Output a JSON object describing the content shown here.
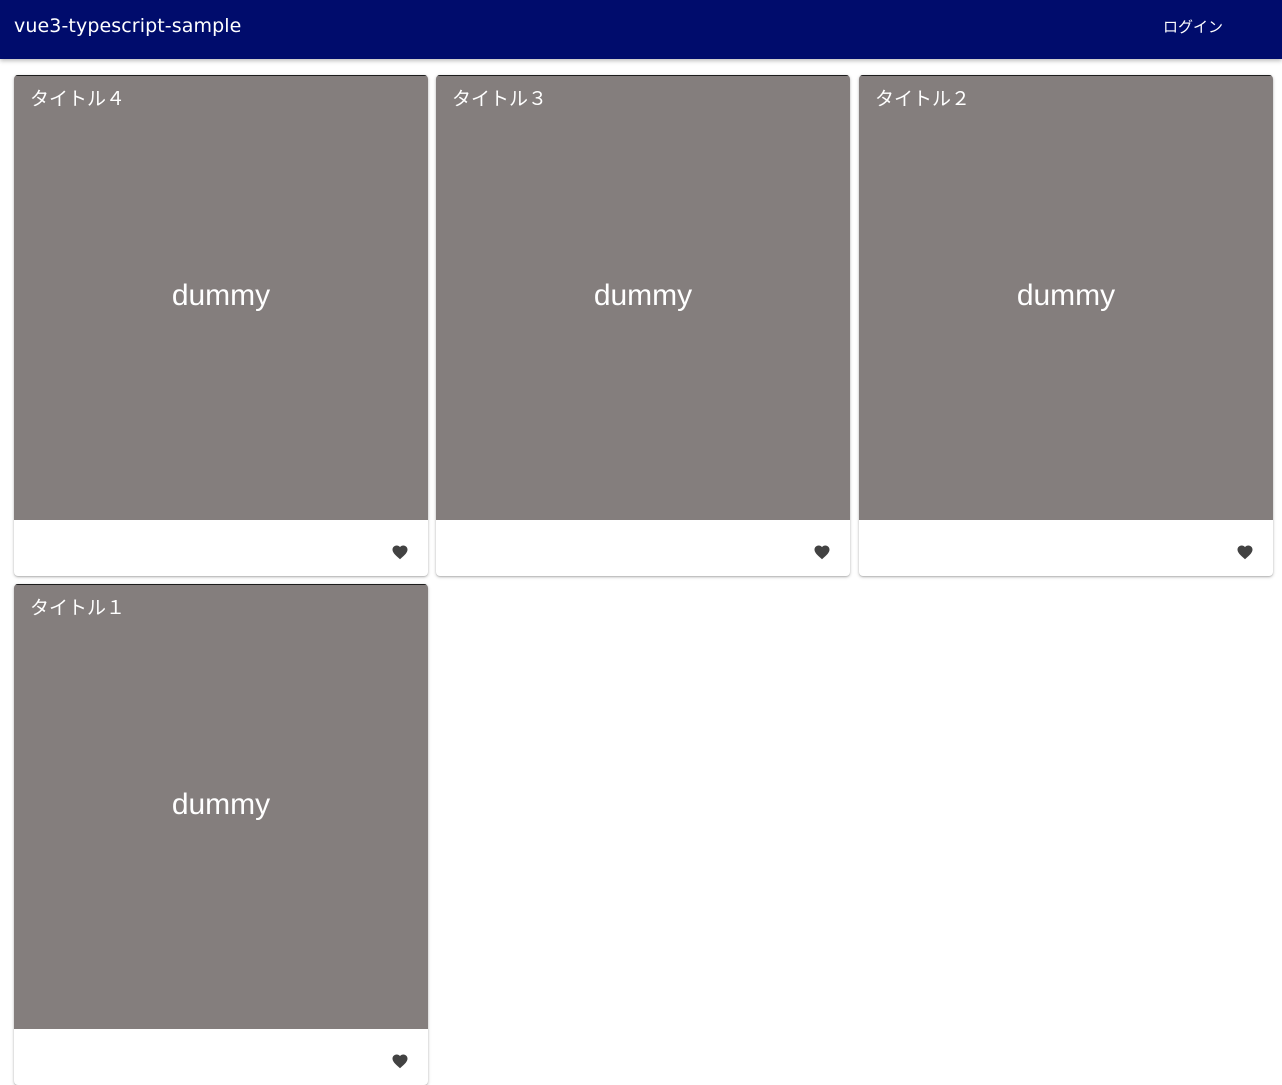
{
  "app_bar": {
    "title": "vue3-typescript-sample",
    "login_label": "ログイン",
    "background_color": "#000c6c"
  },
  "cards": [
    {
      "title": "タイトル４",
      "image_text": "dummy",
      "action_icon": "heart-icon"
    },
    {
      "title": "タイトル３",
      "image_text": "dummy",
      "action_icon": "heart-icon"
    },
    {
      "title": "タイトル２",
      "image_text": "dummy",
      "action_icon": "heart-icon"
    },
    {
      "title": "タイトル１",
      "image_text": "dummy",
      "action_icon": "heart-icon"
    }
  ],
  "colors": {
    "image_placeholder": "#847e7d",
    "icon": "#424242"
  }
}
